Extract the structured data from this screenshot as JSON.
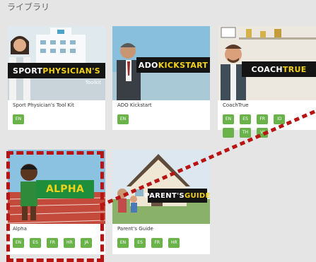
{
  "header": {
    "title": "ライブラリ"
  },
  "cards": [
    {
      "title": "Sport Physician's Tool Kit",
      "banner": [
        "SPORT",
        "PHYSICIAN'S"
      ],
      "banner_sub": "Toolkit",
      "langs": [
        "EN"
      ]
    },
    {
      "title": "ADO Kickstart",
      "banner": [
        "ADO",
        "KICKSTART"
      ],
      "langs": [
        "EN"
      ]
    },
    {
      "title": "CoachTrue",
      "banner": [
        "COACH",
        "TRUE"
      ],
      "langs": [
        "EN",
        "ES",
        "FR",
        "ID",
        "",
        "TH",
        "VI"
      ]
    },
    {
      "title": "Alpha",
      "banner": [
        "ALPHA",
        ""
      ],
      "langs": [
        "EN",
        "ES",
        "FR",
        "HR",
        "JA"
      ]
    },
    {
      "title": "Parent's Guide",
      "banner": [
        "PARENT'S",
        "GUIDE"
      ],
      "langs": [
        "EN",
        "ES",
        "FR",
        "HR"
      ]
    }
  ],
  "colors": {
    "accent_green": "#6ab34a",
    "banner_yellow": "#f3d31a",
    "annotation_red": "#b81414"
  }
}
